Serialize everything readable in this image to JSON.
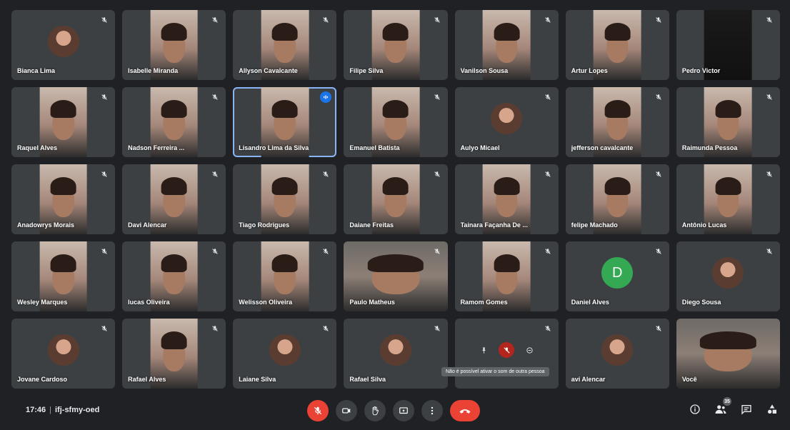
{
  "participants": [
    {
      "name": "Bianca Lima",
      "type": "avatar"
    },
    {
      "name": "Isabelle Miranda",
      "type": "video"
    },
    {
      "name": "Allyson Cavalcante",
      "type": "video"
    },
    {
      "name": "Filipe Silva",
      "type": "video"
    },
    {
      "name": "Vanilson Sousa",
      "type": "video"
    },
    {
      "name": "Artur Lopes",
      "type": "video"
    },
    {
      "name": "Pedro Victor",
      "type": "dark"
    },
    {
      "name": "Raquel Alves",
      "type": "video"
    },
    {
      "name": "Nadson Ferreira ...",
      "type": "video"
    },
    {
      "name": "Lisandro Lima da Silva",
      "type": "video",
      "speaking": true
    },
    {
      "name": "Emanuel Batista",
      "type": "video"
    },
    {
      "name": "Aulyo Micael",
      "type": "avatar"
    },
    {
      "name": "jefferson cavalcante",
      "type": "video"
    },
    {
      "name": "Raimunda Pessoa",
      "type": "video"
    },
    {
      "name": "Anadowrys Morais",
      "type": "video"
    },
    {
      "name": "Davi Alencar",
      "type": "video"
    },
    {
      "name": "Tiago Rodrigues",
      "type": "video"
    },
    {
      "name": "Daiane Freitas",
      "type": "video"
    },
    {
      "name": "Tainara Façanha De ...",
      "type": "video"
    },
    {
      "name": "felipe Machado",
      "type": "video"
    },
    {
      "name": "Antônio Lucas",
      "type": "video"
    },
    {
      "name": "Wesley Marques",
      "type": "video"
    },
    {
      "name": "lucas Oliveira",
      "type": "video"
    },
    {
      "name": "Welisson Oliveira",
      "type": "video"
    },
    {
      "name": "Paulo Matheus",
      "type": "wide"
    },
    {
      "name": "Ramom Gomes",
      "type": "video"
    },
    {
      "name": "Daniel Alves",
      "type": "letter",
      "letter": "D"
    },
    {
      "name": "Diego Sousa",
      "type": "avatar"
    },
    {
      "name": "Jovane Cardoso",
      "type": "avatar"
    },
    {
      "name": "Rafael Alves",
      "type": "video"
    },
    {
      "name": "Laiane Silva",
      "type": "avatar"
    },
    {
      "name": "Rafael Silva",
      "type": "avatar"
    },
    {
      "name": "",
      "type": "hover"
    },
    {
      "name": "avi Alencar",
      "type": "avatar"
    },
    {
      "name": "Você",
      "type": "wide",
      "self": true
    }
  ],
  "tooltip": "Não é possível ativar o som de outra pessoa",
  "meeting": {
    "time": "17:46",
    "separator": "|",
    "code": "ifj-sfmy-oed"
  },
  "people_count": "35",
  "colors": {
    "background": "#202124",
    "tile": "#3c4043",
    "accent": "#1a73e8",
    "danger": "#ea4335",
    "avatar_letter": "#34a853"
  },
  "controls": [
    {
      "name": "mic-off",
      "icon": "mic-off-icon"
    },
    {
      "name": "camera",
      "icon": "camera-icon"
    },
    {
      "name": "raise-hand",
      "icon": "hand-icon"
    },
    {
      "name": "present",
      "icon": "present-icon"
    },
    {
      "name": "more",
      "icon": "more-vert-icon"
    },
    {
      "name": "leave-call",
      "icon": "phone-hangup-icon"
    }
  ]
}
